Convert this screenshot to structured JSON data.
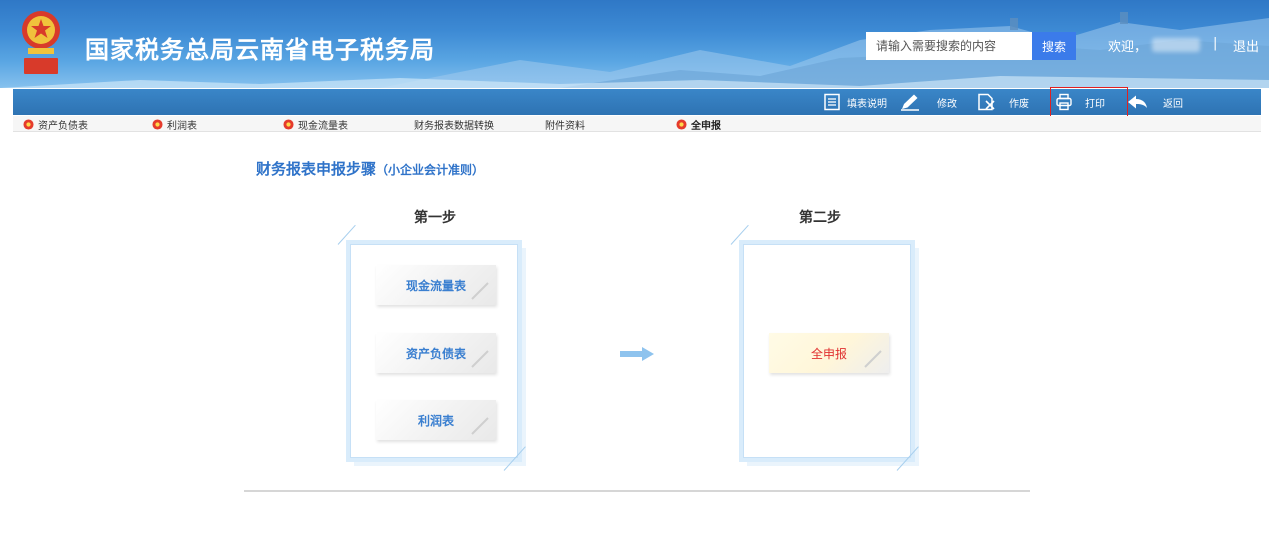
{
  "header": {
    "site_title": "国家税务总局云南省电子税务局",
    "search_placeholder": "请输入需要搜索的内容",
    "search_button": "搜索",
    "welcome": "欢迎，",
    "separator": "|",
    "logout": "退出"
  },
  "toolbar": {
    "items": [
      {
        "label": "填表说明",
        "icon": "document-lines-icon"
      },
      {
        "label": "修改",
        "icon": "pencil-icon"
      },
      {
        "label": "作废",
        "icon": "document-x-icon"
      },
      {
        "label": "打印",
        "icon": "printer-icon"
      },
      {
        "label": "返回",
        "icon": "back-arrow-icon"
      }
    ]
  },
  "tabs": [
    {
      "label": "资产负债表",
      "icon": "gear-flower-icon"
    },
    {
      "label": "利润表",
      "icon": "gear-flower-icon"
    },
    {
      "label": "现金流量表",
      "icon": "gear-flower-icon"
    },
    {
      "label": "财务报表数据转换"
    },
    {
      "label": "附件资料"
    },
    {
      "label": "全申报",
      "icon": "gear-flower-icon"
    }
  ],
  "main": {
    "title": "财务报表申报步骤",
    "subtitle": "（小企业会计准则）",
    "step1": {
      "title": "第一步",
      "cards": [
        "现金流量表",
        "资产负债表",
        "利润表"
      ]
    },
    "step2": {
      "title": "第二步",
      "cards": [
        "全申报"
      ]
    }
  },
  "colors": {
    "header_blue": "#2f78c6",
    "toolbar_blue": "#2e73b3",
    "title_blue": "#2f73c9",
    "highlight_red": "#e02020",
    "declare_red": "#e03030"
  }
}
